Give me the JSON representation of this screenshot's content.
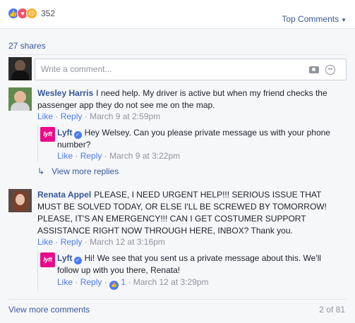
{
  "reactions": {
    "icons": [
      "like-icon",
      "love-icon",
      "angry-icon"
    ],
    "count": "352"
  },
  "top_comments": {
    "label": "Top Comments",
    "caret": "▼"
  },
  "shares": "27 shares",
  "composer": {
    "placeholder": "Write a comment..."
  },
  "comments": [
    {
      "author": "Wesley Harris",
      "text": "I need help. My driver is active but when my friend checks the passenger app they do not see me on the map.",
      "like": "Like",
      "reply": "Reply",
      "sep": "·",
      "time": "March 9 at 2:59pm",
      "reply_item": {
        "author": "Lyft",
        "avatar_text": "lyft",
        "text": "Hey Welsey. Can you please private message us with your phone number?",
        "like": "Like",
        "reply": "Reply",
        "sep": "·",
        "time": "March 9 at 3:22pm"
      },
      "view_more_replies": "View more replies"
    },
    {
      "author": "Renata Appel",
      "text": "PLEASE, I NEED URGENT HELP!!! SERIOUS ISSUE THAT MUST BE SOLVED TODAY, OR ELSE I'LL BE SCREWED BY TOMORROW! PLEASE, IT'S AN EMERGENCY!!! CAN I GET COSTUMER SUPPORT ASSISTANCE RIGHT NOW THROUGH HERE, INBOX? Thank you.",
      "like": "Like",
      "reply": "Reply",
      "sep": "·",
      "time": "March 12 at 3:16pm",
      "reply_item": {
        "author": "Lyft",
        "avatar_text": "lyft",
        "text": "Hi! We see that you sent us a private message about this. We'll follow up with you there, Renata!",
        "like": "Like",
        "reply": "Reply",
        "sep": "·",
        "like_count": "1",
        "time": "March 12 at 3:29pm"
      }
    }
  ],
  "footer": {
    "view_more_comments": "View more comments",
    "pager": "2 of 81"
  },
  "colors": {
    "link": "#365899",
    "action": "#4b7bf0",
    "meta": "#90949c",
    "lyft": "#ea0b8c"
  }
}
